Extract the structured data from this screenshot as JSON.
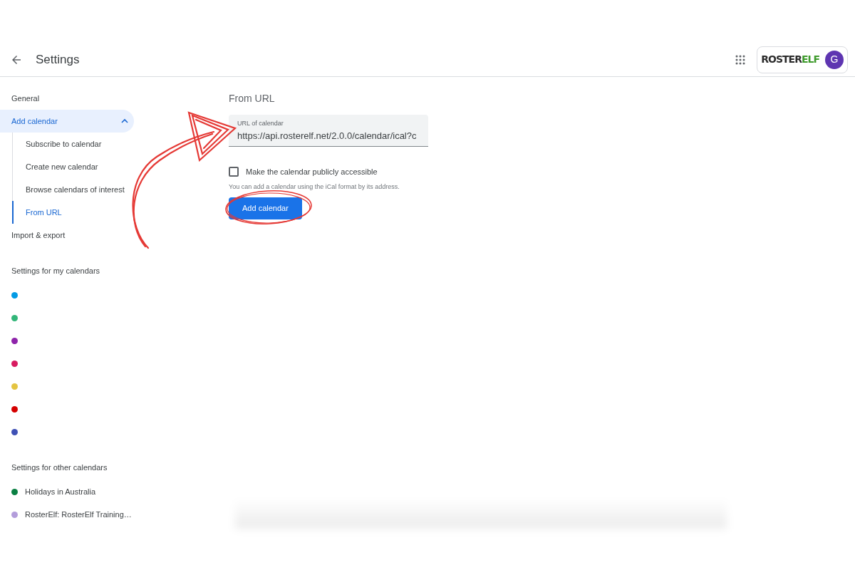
{
  "header": {
    "title": "Settings",
    "logo_parts": [
      {
        "text": "ROSTER",
        "color": "#2b2b2b"
      },
      {
        "text": "ELF",
        "color": "#3f9b2d"
      }
    ],
    "avatar": "G"
  },
  "sidebar": {
    "items": [
      {
        "label": "General",
        "selected": false
      },
      {
        "label": "Add calendar",
        "selected": true,
        "expanded": true,
        "children": [
          {
            "label": "Subscribe to calendar",
            "selected": false
          },
          {
            "label": "Create new calendar",
            "selected": false
          },
          {
            "label": "Browse calendars of interest",
            "selected": false
          },
          {
            "label": "From URL",
            "selected": true
          }
        ]
      },
      {
        "label": "Import & export",
        "selected": false
      }
    ],
    "my_calendars": {
      "heading": "Settings for my calendars",
      "calendars": [
        {
          "color": "#039be5"
        },
        {
          "color": "#33b679"
        },
        {
          "color": "#8e24aa"
        },
        {
          "color": "#d81b60"
        },
        {
          "color": "#e4c441"
        },
        {
          "color": "#d50000"
        },
        {
          "color": "#3f51b5"
        }
      ]
    },
    "other_calendars": {
      "heading": "Settings for other calendars",
      "calendars": [
        {
          "label": "Holidays in Australia",
          "color": "#0b8043"
        },
        {
          "label": "RosterElf: RosterElf Training…",
          "color": "#b39ddb"
        }
      ]
    }
  },
  "main": {
    "heading": "From URL",
    "url_field": {
      "label": "URL of calendar",
      "value": "https://api.rosterelf.net/2.0.0/calendar/ical?c"
    },
    "public_checkbox": {
      "label": "Make the calendar publicly accessible",
      "checked": false
    },
    "helper": "You can add a calendar using the iCal format by its address.",
    "button": "Add calendar"
  }
}
